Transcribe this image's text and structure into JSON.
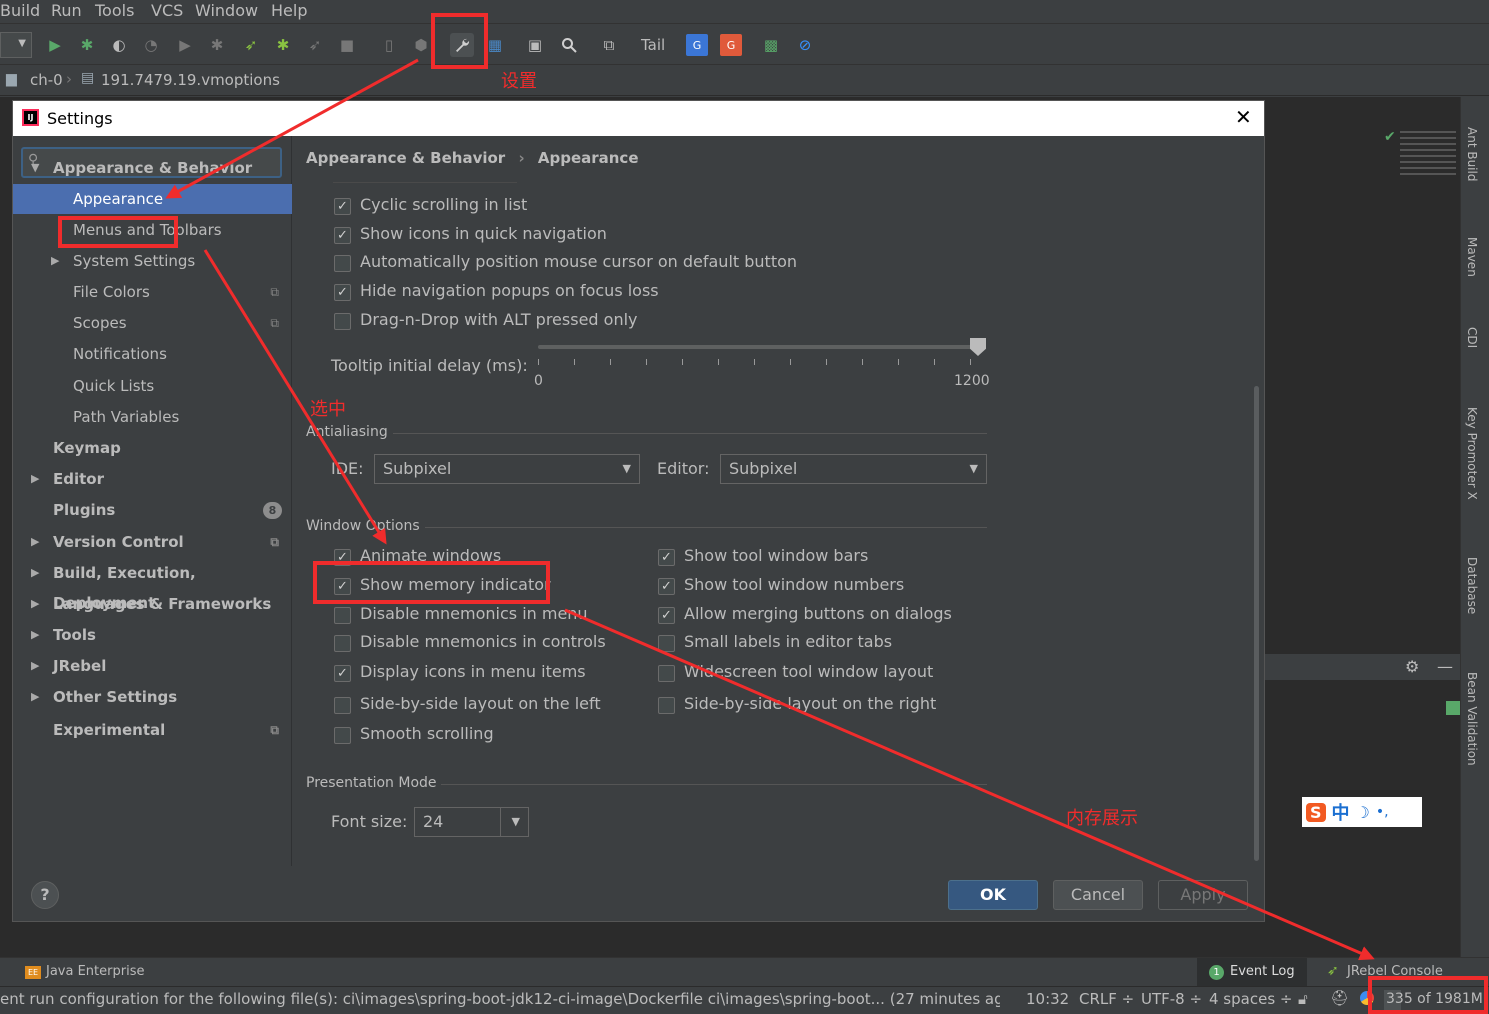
{
  "menubar": {
    "items": [
      "Build",
      "Run",
      "Tools",
      "VCS",
      "Window",
      "Help"
    ]
  },
  "toolbar": {
    "tail_label": "Tail"
  },
  "navbar": {
    "folder": "ch-0",
    "file": "191.7479.19.vmoptions"
  },
  "annotations": {
    "settings_label": "设置",
    "select_label": "选中",
    "memory_label": "内存展示"
  },
  "dialog": {
    "title": "Settings",
    "search_placeholder": "",
    "breadcrumb": {
      "parent": "Appearance & Behavior",
      "current": "Appearance"
    },
    "tree": [
      {
        "label": "Appearance & Behavior",
        "level": 0,
        "bold": true,
        "arrow": "down"
      },
      {
        "label": "Appearance",
        "level": 1,
        "selected": true
      },
      {
        "label": "Menus and Toolbars",
        "level": 1
      },
      {
        "label": "System Settings",
        "level": 1,
        "arrow": "right"
      },
      {
        "label": "File Colors",
        "level": 1,
        "copy": true
      },
      {
        "label": "Scopes",
        "level": 1,
        "copy": true
      },
      {
        "label": "Notifications",
        "level": 1
      },
      {
        "label": "Quick Lists",
        "level": 1
      },
      {
        "label": "Path Variables",
        "level": 1
      },
      {
        "label": "Keymap",
        "level": 0,
        "bold": true
      },
      {
        "label": "Editor",
        "level": 0,
        "bold": true,
        "arrow": "right"
      },
      {
        "label": "Plugins",
        "level": 0,
        "bold": true,
        "badge": "8"
      },
      {
        "label": "Version Control",
        "level": 0,
        "bold": true,
        "arrow": "right",
        "copy": true
      },
      {
        "label": "Build, Execution, Deployment",
        "level": 0,
        "bold": true,
        "arrow": "right"
      },
      {
        "label": "Languages & Frameworks",
        "level": 0,
        "bold": true,
        "arrow": "right"
      },
      {
        "label": "Tools",
        "level": 0,
        "bold": true,
        "arrow": "right"
      },
      {
        "label": "JRebel",
        "level": 0,
        "bold": true,
        "arrow": "right"
      },
      {
        "label": "Other Settings",
        "level": 0,
        "bold": true,
        "arrow": "right"
      },
      {
        "label": "Experimental",
        "level": 0,
        "bold": true,
        "copy": true
      }
    ],
    "ui_options": [
      {
        "label": "Cyclic scrolling in list",
        "checked": true
      },
      {
        "label": "Show icons in quick navigation",
        "checked": true
      },
      {
        "label": "Automatically position mouse cursor on default button",
        "checked": false
      },
      {
        "label": "Hide navigation popups on focus loss",
        "checked": true
      },
      {
        "label": "Drag-n-Drop with ALT pressed only",
        "checked": false
      }
    ],
    "tooltip": {
      "label": "Tooltip initial delay (ms):",
      "min": "0",
      "max": "1200",
      "value": 1200
    },
    "antialiasing": {
      "title": "Antialiasing",
      "ide_label": "IDE:",
      "ide_value": "Subpixel",
      "editor_label": "Editor:",
      "editor_value": "Subpixel"
    },
    "window_options": {
      "title": "Window Options",
      "left": [
        {
          "label": "Animate windows",
          "checked": true
        },
        {
          "label": "Show memory indicator",
          "checked": true
        },
        {
          "label": "Disable mnemonics in menu",
          "checked": false
        },
        {
          "label": "Disable mnemonics in controls",
          "checked": false
        },
        {
          "label": "Display icons in menu items",
          "checked": true
        },
        {
          "label": "Side-by-side layout on the left",
          "checked": false
        },
        {
          "label": "Smooth scrolling",
          "checked": false
        }
      ],
      "right": [
        {
          "label": "Show tool window bars",
          "checked": true
        },
        {
          "label": "Show tool window numbers",
          "checked": true
        },
        {
          "label": "Allow merging buttons on dialogs",
          "checked": true
        },
        {
          "label": "Small labels in editor tabs",
          "checked": false
        },
        {
          "label": "Widescreen tool window layout",
          "checked": false
        },
        {
          "label": "Side-by-side layout on the right",
          "checked": false
        }
      ]
    },
    "presentation": {
      "title": "Presentation Mode",
      "font_label": "Font size:",
      "font_value": "24"
    },
    "buttons": {
      "ok": "OK",
      "cancel": "Cancel",
      "apply": "Apply",
      "help": "?"
    }
  },
  "right_tools": [
    "Ant Build",
    "Maven",
    "CDI",
    "Key Promoter X",
    "Database",
    "Bean Validation"
  ],
  "bottom_tools": {
    "java_enterprise": "Java Enterprise",
    "event_log": "Event Log",
    "event_log_badge": "1",
    "jrebel_console": "JRebel Console"
  },
  "status": {
    "message": "ent run configuration for the following file(s): ci\\images\\spring-boot-jdk12-ci-image\\Dockerfile ci\\images\\spring-boot... (27 minutes ago)",
    "position": "10:32",
    "line_sep": "CRLF ÷",
    "encoding": "UTF-8 ÷",
    "indent": "4 spaces ÷",
    "memory": "335 of 1981M",
    "memory_used_fraction": 0.17
  },
  "ime": {
    "zh": "中",
    "moon": "☽",
    "dot": "•,"
  },
  "colors": {
    "selection": "#4b6eaf",
    "accent_red": "#f02c2c",
    "ok_button": "#365880"
  }
}
